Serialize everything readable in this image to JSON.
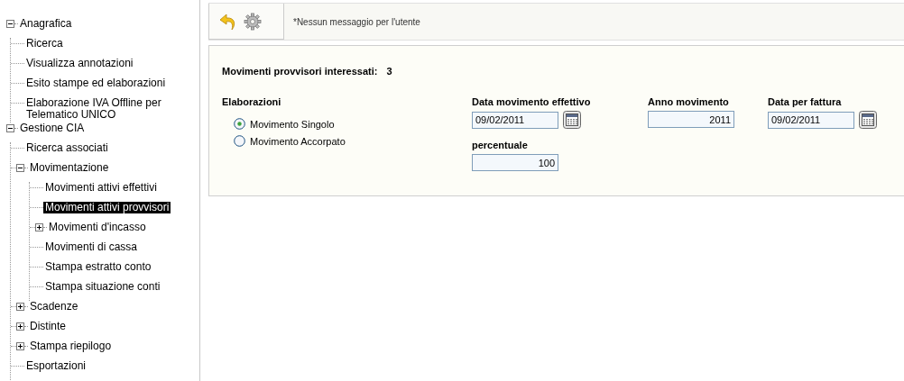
{
  "tree": [
    {
      "label": "Anagrafica",
      "expanded": true,
      "selected": false,
      "children": [
        {
          "label": "Ricerca",
          "selected": false
        },
        {
          "label": "Visualizza annotazioni",
          "selected": false
        },
        {
          "label": "Esito stampe ed elaborazioni",
          "selected": false
        },
        {
          "label": "Elaborazione IVA Offline per Telematico UNICO",
          "selected": false
        }
      ]
    },
    {
      "label": "Gestione CIA",
      "expanded": true,
      "selected": false,
      "children": [
        {
          "label": "Ricerca associati",
          "selected": false
        },
        {
          "label": "Movimentazione",
          "expanded": true,
          "selected": false,
          "children": [
            {
              "label": "Movimenti attivi effettivi",
              "selected": false
            },
            {
              "label": "Movimenti attivi provvisori",
              "selected": true
            },
            {
              "label": "Movimenti d'incasso",
              "expanded": false,
              "selected": false
            },
            {
              "label": "Movimenti di cassa",
              "selected": false
            },
            {
              "label": "Stampa estratto conto",
              "selected": false
            },
            {
              "label": "Stampa situazione conti",
              "selected": false
            }
          ]
        },
        {
          "label": "Scadenze",
          "expanded": false,
          "selected": false
        },
        {
          "label": "Distinte",
          "expanded": false,
          "selected": false
        },
        {
          "label": "Stampa riepilogo",
          "expanded": false,
          "selected": false
        },
        {
          "label": "Esportazioni",
          "selected": false
        }
      ]
    }
  ],
  "toolbar": {
    "message": "*Nessun messaggio per l'utente"
  },
  "form": {
    "count_label": "Movimenti provvisori interessati:",
    "count": "3",
    "group_label": "Elaborazioni",
    "options": [
      {
        "label": "Movimento Singolo",
        "selected": true
      },
      {
        "label": "Movimento Accorpato",
        "selected": false
      }
    ],
    "field_rows": [
      [
        {
          "label": "Data movimento effettivo",
          "value": "09/02/2011",
          "kind": "date"
        },
        {
          "label": "Anno movimento",
          "value": "2011",
          "kind": "number"
        },
        {
          "label": "Data per fattura",
          "value": "09/02/2011",
          "kind": "date"
        }
      ],
      [
        {
          "label": "percentuale",
          "value": "100",
          "kind": "number"
        }
      ]
    ]
  }
}
